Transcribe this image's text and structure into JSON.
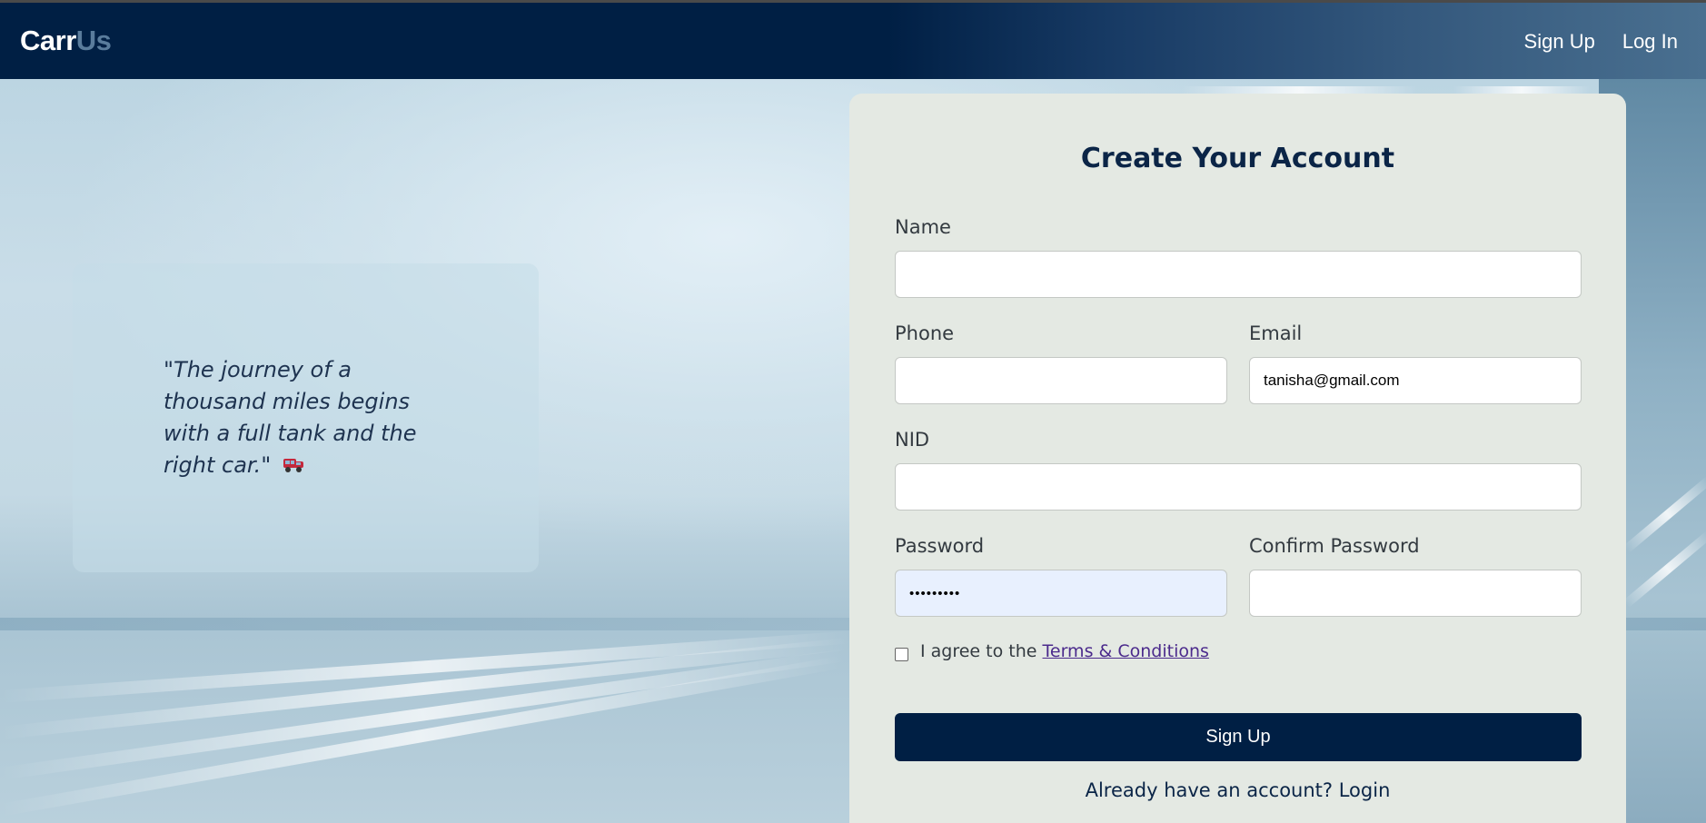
{
  "header": {
    "logo_primary": "Carr",
    "logo_accent": "Us",
    "nav": [
      "Sign Up",
      "Log In"
    ]
  },
  "hero": {
    "quote": "\"The journey of a thousand miles begins with a full tank and the right car.\"",
    "quote_icon": "car-icon"
  },
  "form": {
    "title": "Create Your Account",
    "fields": {
      "name": {
        "label": "Name",
        "value": ""
      },
      "phone": {
        "label": "Phone",
        "value": ""
      },
      "email": {
        "label": "Email",
        "value": "tanisha@gmail.com"
      },
      "nid": {
        "label": "NID",
        "value": ""
      },
      "password": {
        "label": "Password",
        "value": "•••••••••"
      },
      "confirm_password": {
        "label": "Confirm Password",
        "value": ""
      }
    },
    "terms_prefix": "I agree to the",
    "terms_link": "Terms & Conditions",
    "terms_checked": false,
    "submit_label": "Sign Up",
    "login_prompt": "Already have an account? Login"
  },
  "colors": {
    "navy": "#001f44",
    "logo_accent": "#5a7c9c",
    "panel_bg": "#e4e9e3",
    "link_purple": "#4b2a8c"
  }
}
